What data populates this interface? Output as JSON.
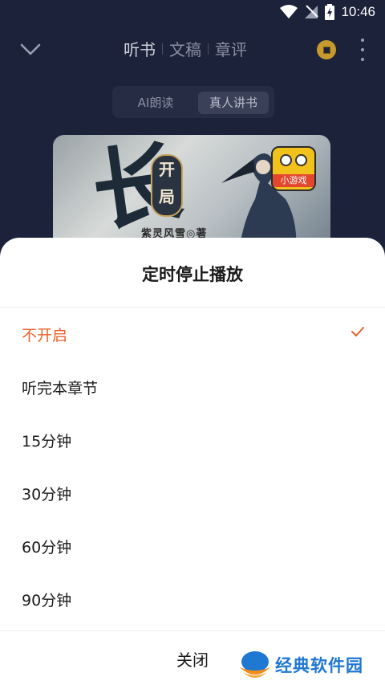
{
  "status_bar": {
    "time": "10:46"
  },
  "header": {
    "tabs": [
      {
        "label": "听书",
        "active": true
      },
      {
        "label": "文稿",
        "active": false
      },
      {
        "label": "章评",
        "active": false
      }
    ],
    "icons": {
      "back": "chevron-down-icon",
      "coin": "coin-icon",
      "more": "more-vertical-icon"
    }
  },
  "mode_switch": {
    "ai_label": "AI朗读",
    "human_label": "真人讲书",
    "selected": "真人讲书"
  },
  "cover": {
    "title_char": "长",
    "badge_text": "开局",
    "author": "紫灵风雪◎著",
    "game_badge": "小游戏"
  },
  "sheet": {
    "title": "定时停止播放",
    "options": [
      {
        "label": "不开启",
        "selected": true
      },
      {
        "label": "听完本章节",
        "selected": false
      },
      {
        "label": "15分钟",
        "selected": false
      },
      {
        "label": "30分钟",
        "selected": false
      },
      {
        "label": "60分钟",
        "selected": false
      },
      {
        "label": "90分钟",
        "selected": false
      }
    ],
    "close_label": "关闭"
  },
  "watermark": {
    "text": "经典软件园"
  },
  "colors": {
    "accent": "#e8622c",
    "background_dark": "#1c2239",
    "sheet_bg": "#ffffff",
    "watermark_blue": "#1f78d1"
  }
}
